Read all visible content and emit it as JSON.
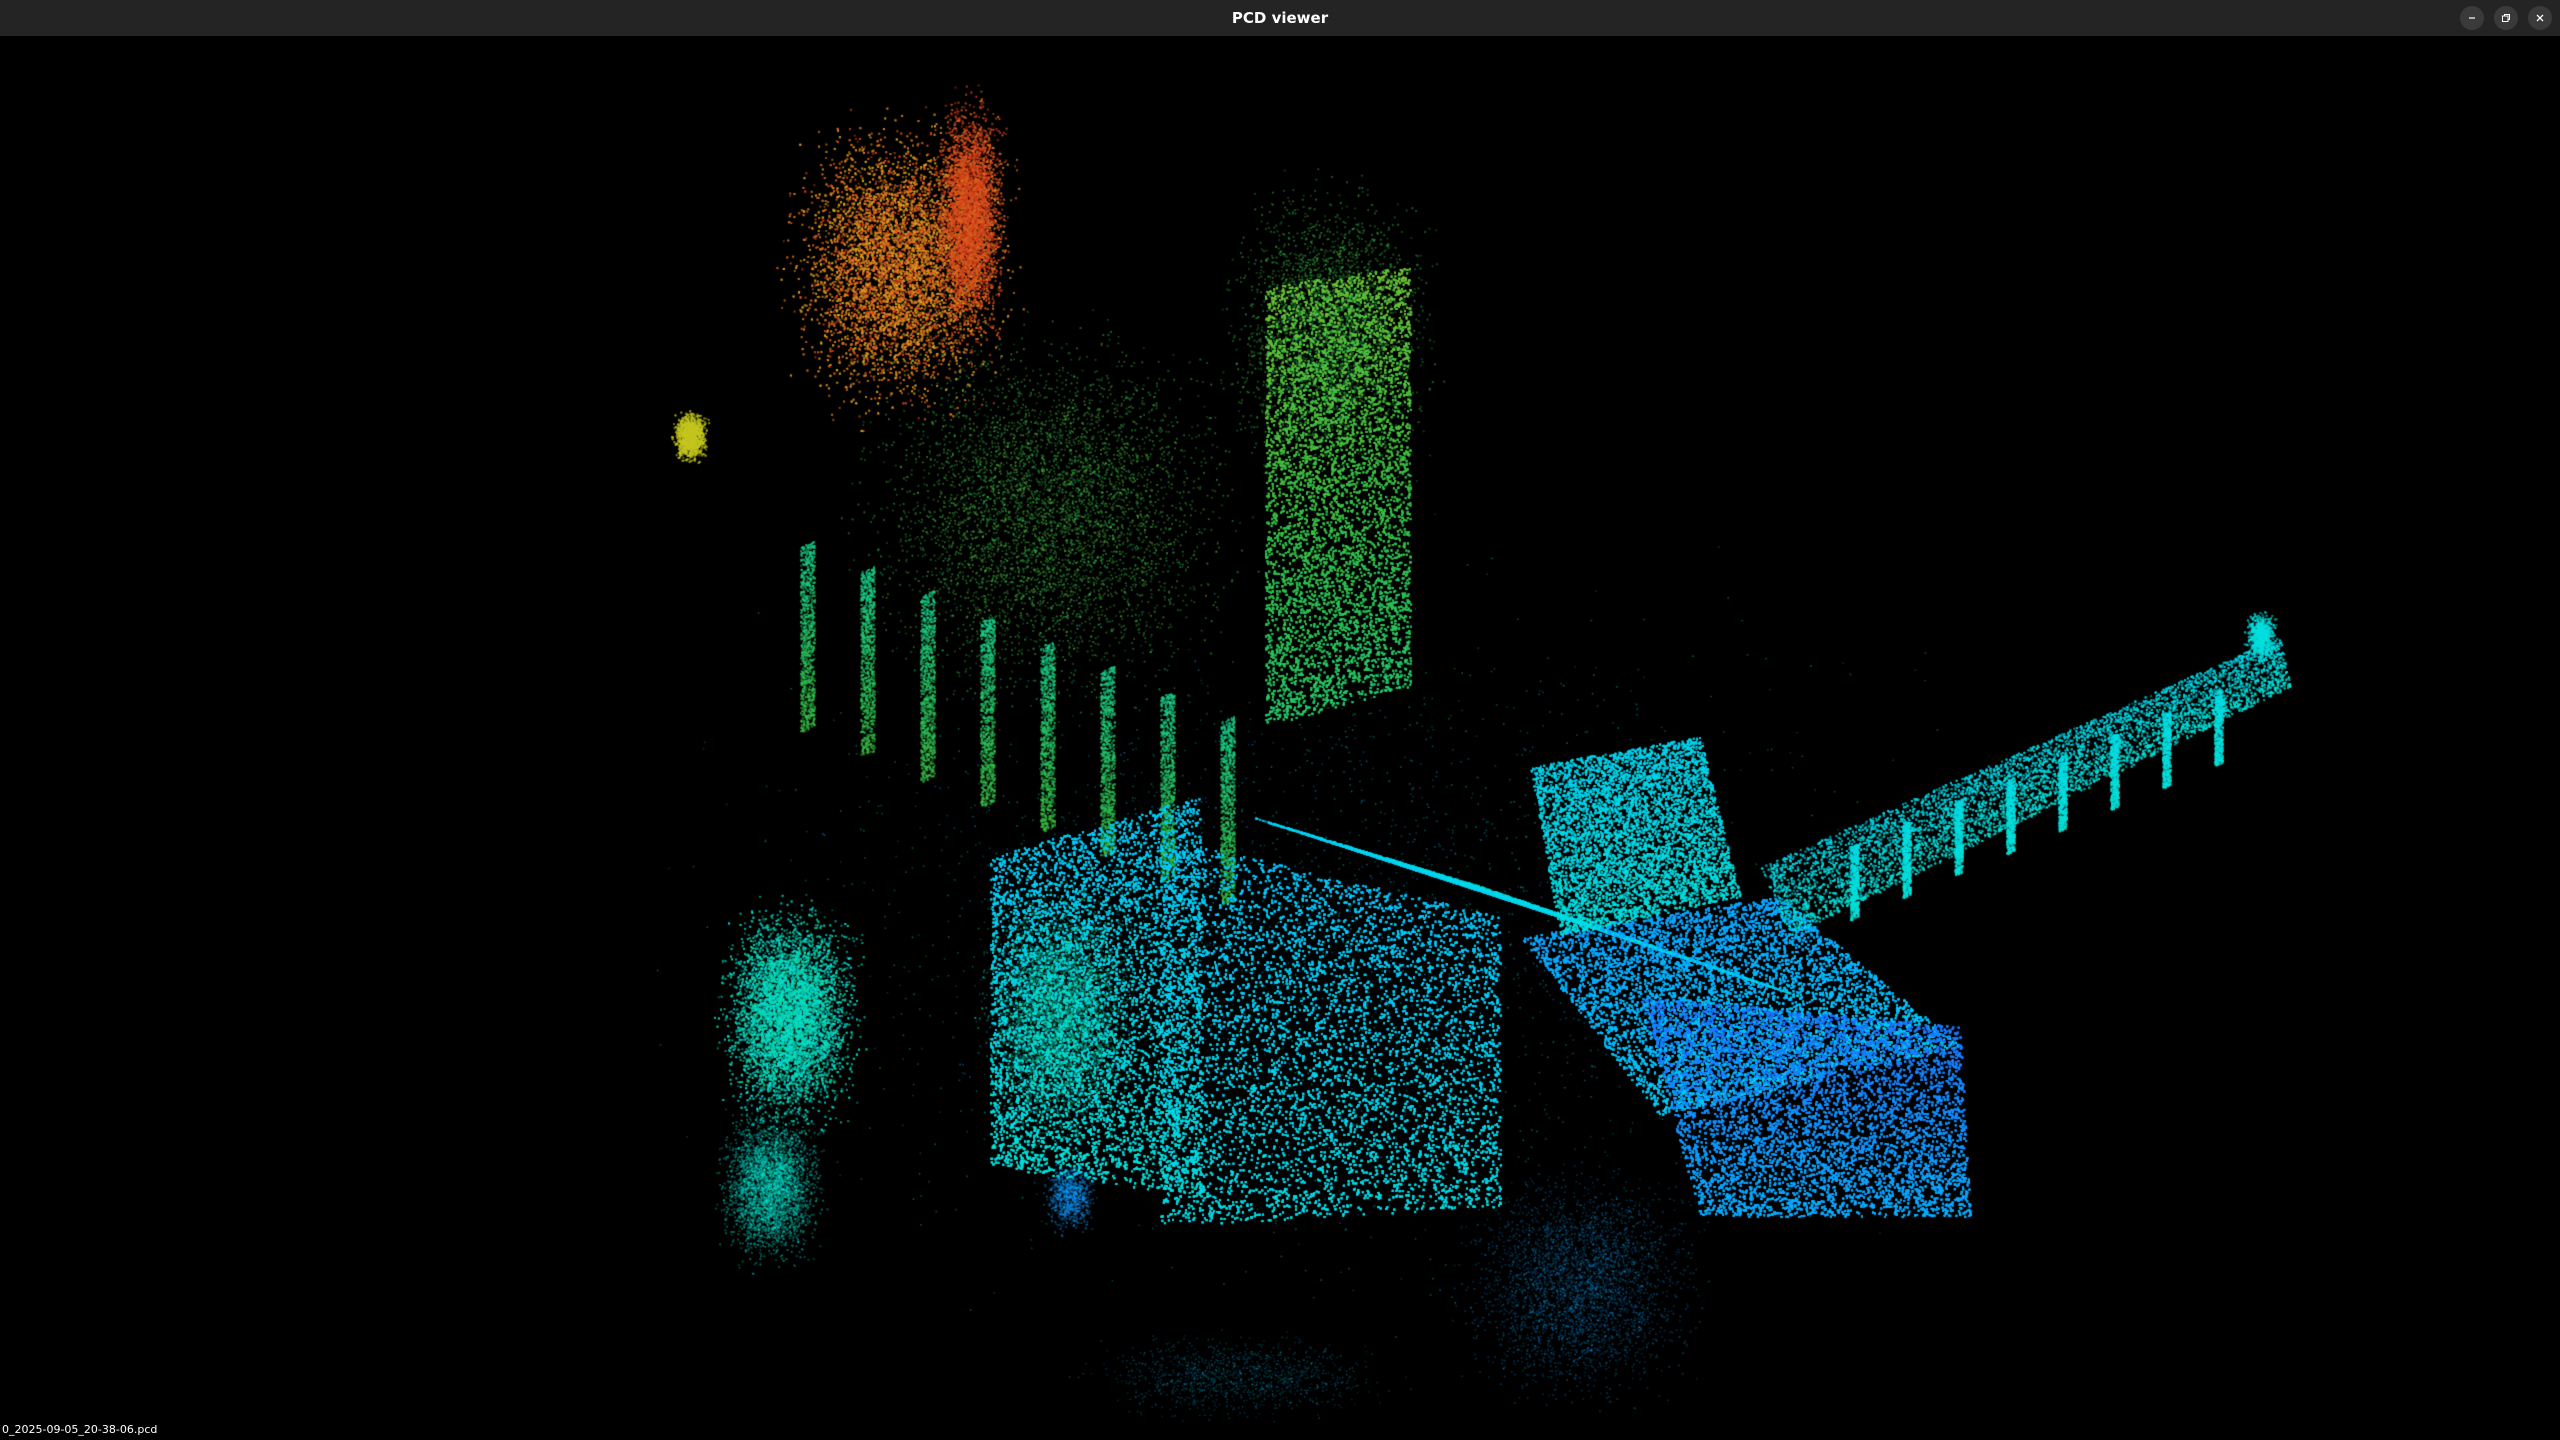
{
  "window": {
    "title": "PCD viewer",
    "controls": {
      "minimize": "minimize-icon",
      "maximize": "restore-icon",
      "close": "close-icon"
    }
  },
  "viewport": {
    "background": "#000000",
    "point_color_scale": [
      "#1e6bff",
      "#00c8ff",
      "#00e0d0",
      "#2fbf4a",
      "#c8c818",
      "#e08a20",
      "#d83018"
    ]
  },
  "status": {
    "filename": "0_2025-09-05_20-38-06.pcd"
  }
}
